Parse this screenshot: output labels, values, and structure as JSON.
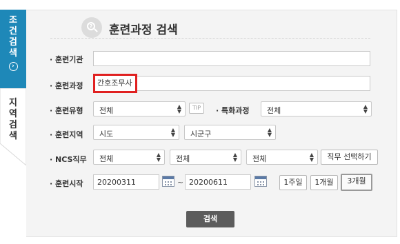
{
  "side_tabs": {
    "active_label": "조건검색",
    "active_icon": "›",
    "inactive_label": "지역검색"
  },
  "title": "훈련과정 검색",
  "title_icon_glyph": "?",
  "fields": {
    "institution": {
      "label": "· 훈련기관",
      "value": ""
    },
    "course": {
      "label": "· 훈련과정",
      "value": "간호조무사"
    },
    "type": {
      "label": "· 훈련유형",
      "value": "전체",
      "tip": "TIP"
    },
    "special": {
      "label": "· 특화과정",
      "value": "전체"
    },
    "region": {
      "label": "· 훈련지역",
      "city": "시도",
      "district": "시군구"
    },
    "ncs": {
      "label": "· NCS직무",
      "level1": "전체",
      "level2": "전체",
      "level3": "전체",
      "select_button": "직무 선택하기"
    },
    "start": {
      "label": "· 훈련시작",
      "from": "20200311",
      "to": "20200611",
      "sep": "~",
      "periods": [
        "1주일",
        "1개월",
        "3개월"
      ],
      "active_period": "3개월"
    }
  },
  "search_button": "검색",
  "colors": {
    "active_tab": "#1e88b8",
    "highlight": "#e02020",
    "search_button": "#5c5c5c"
  },
  "icons": {
    "select_arrow": "⬍",
    "calendar": "calendar-icon"
  }
}
